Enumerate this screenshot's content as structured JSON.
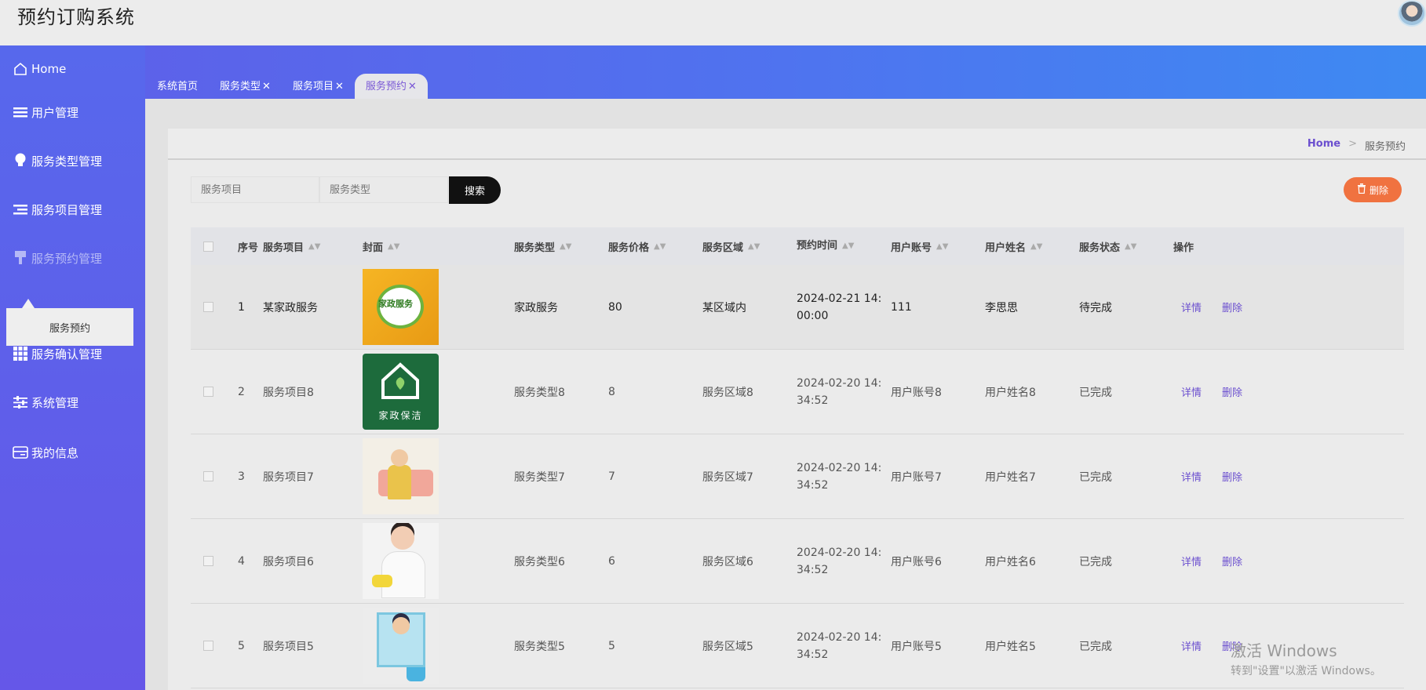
{
  "app": {
    "title": "预约订购系统"
  },
  "sidebar": {
    "items": [
      {
        "label": "Home",
        "icon": "home-icon"
      },
      {
        "label": "用户管理",
        "icon": "list-icon"
      },
      {
        "label": "服务类型管理",
        "icon": "bulb-icon"
      },
      {
        "label": "服务项目管理",
        "icon": "list-indent-icon"
      },
      {
        "label": "服务预约管理",
        "icon": "brush-icon"
      },
      {
        "label": "服务确认管理",
        "icon": "grid-icon"
      },
      {
        "label": "系统管理",
        "icon": "sliders-icon"
      },
      {
        "label": "我的信息",
        "icon": "card-icon"
      }
    ],
    "submenu_label": "服务预约"
  },
  "tabs": [
    {
      "label": "系统首页",
      "closable": false
    },
    {
      "label": "服务类型",
      "closable": true
    },
    {
      "label": "服务项目",
      "closable": true
    },
    {
      "label": "服务预约",
      "closable": true,
      "active": true
    }
  ],
  "breadcrumb": {
    "home": "Home",
    "sep": ">",
    "current": "服务预约"
  },
  "search": {
    "item_placeholder": "服务项目",
    "type_placeholder": "服务类型",
    "button": "搜索",
    "delete_button": "删除"
  },
  "table": {
    "headers": {
      "index": "序号",
      "item": "服务项目",
      "cover": "封面",
      "type": "服务类型",
      "price": "服务价格",
      "area": "服务区域",
      "time": "预约时间",
      "account": "用户账号",
      "name": "用户姓名",
      "status": "服务状态",
      "ops": "操作"
    },
    "detail_label": "详情",
    "delete_label": "删除",
    "rows": [
      {
        "index": "1",
        "item": "某家政服务",
        "cover_label": "家政服务",
        "type": "家政服务",
        "price": "80",
        "area": "某区域内",
        "time_line1": "2024-02-21 14:",
        "time_line2": "00:00",
        "account": "111",
        "name": "李思思",
        "status": "待完成"
      },
      {
        "index": "2",
        "item": "服务项目8",
        "cover_label": "家政保洁",
        "type": "服务类型8",
        "price": "8",
        "area": "服务区域8",
        "time_line1": "2024-02-20 14:",
        "time_line2": "34:52",
        "account": "用户账号8",
        "name": "用户姓名8",
        "status": "已完成"
      },
      {
        "index": "3",
        "item": "服务项目7",
        "cover_label": "",
        "type": "服务类型7",
        "price": "7",
        "area": "服务区域7",
        "time_line1": "2024-02-20 14:",
        "time_line2": "34:52",
        "account": "用户账号7",
        "name": "用户姓名7",
        "status": "已完成"
      },
      {
        "index": "4",
        "item": "服务项目6",
        "cover_label": "",
        "type": "服务类型6",
        "price": "6",
        "area": "服务区域6",
        "time_line1": "2024-02-20 14:",
        "time_line2": "34:52",
        "account": "用户账号6",
        "name": "用户姓名6",
        "status": "已完成"
      },
      {
        "index": "5",
        "item": "服务项目5",
        "cover_label": "",
        "type": "服务类型5",
        "price": "5",
        "area": "服务区域5",
        "time_line1": "2024-02-20 14:",
        "time_line2": "34:52",
        "account": "用户账号5",
        "name": "用户姓名5",
        "status": "已完成"
      }
    ]
  },
  "watermark": {
    "line1": "激活 Windows",
    "line2": "转到\"设置\"以激活 Windows。"
  },
  "colors": {
    "accent": "#6b4fcf",
    "delete": "#f07240",
    "sidebar_top": "#5768ec",
    "sidebar_bottom": "#6557e8"
  }
}
